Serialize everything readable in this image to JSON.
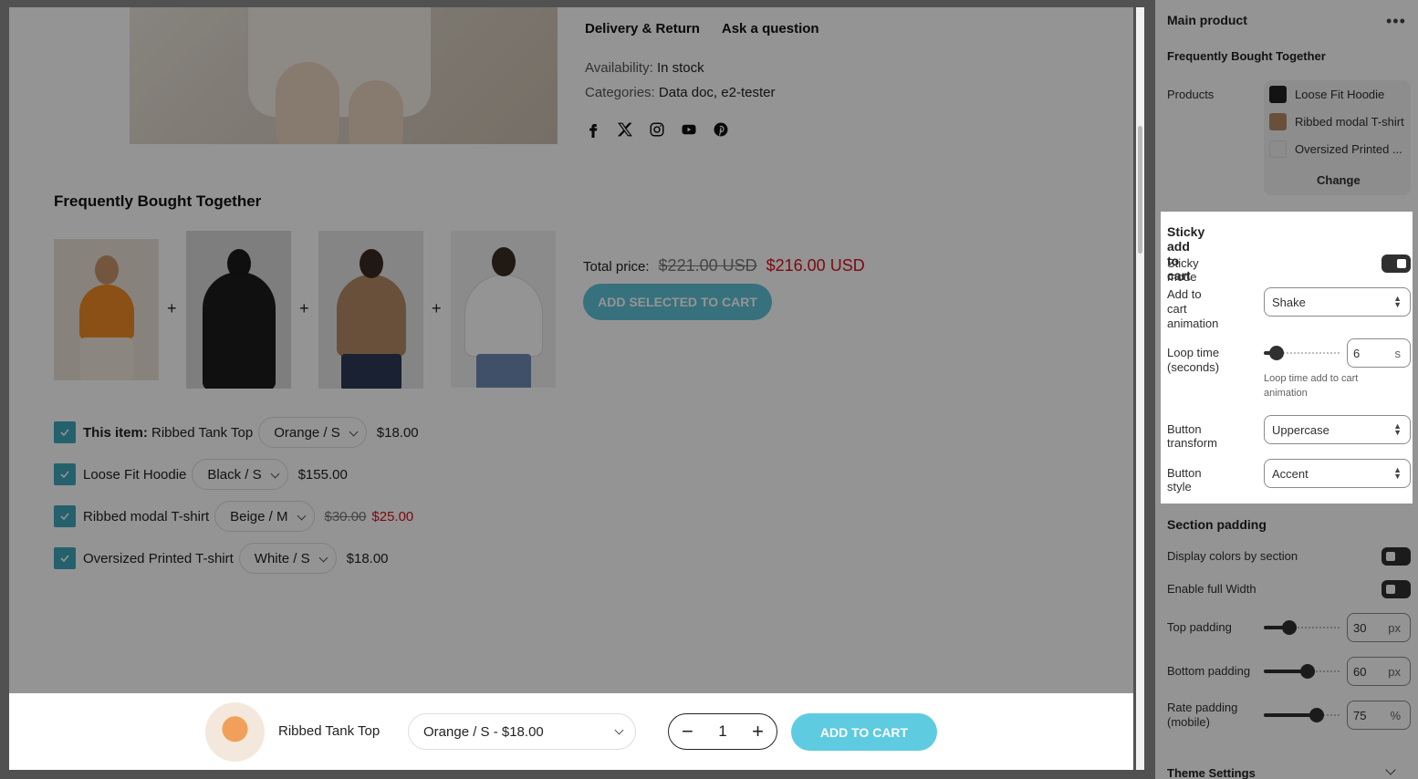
{
  "product_info": {
    "tabs": [
      "Delivery & Return",
      "Ask a question"
    ],
    "availability_label": "Availability:",
    "availability_value": "In stock",
    "categories_label": "Categories:",
    "categories_value": "Data doc, e2-tester",
    "socials": [
      "facebook-icon",
      "x-icon",
      "instagram-icon",
      "youtube-icon",
      "pinterest-icon"
    ]
  },
  "fbt": {
    "title": "Frequently Bought Together",
    "total_label": "Total price:",
    "total_old": "$221.00 USD",
    "total_new": "$216.00 USD",
    "add_button": "ADD SELECTED TO CART",
    "items": [
      {
        "prefix": "This item:",
        "name": "Ribbed Tank Top",
        "variant": "Orange / S",
        "price": "$18.00"
      },
      {
        "name": "Loose Fit Hoodie",
        "variant": "Black / S",
        "price": "$155.00"
      },
      {
        "name": "Ribbed modal T-shirt",
        "variant": "Beige / M",
        "old_price": "$30.00",
        "price": "$25.00"
      },
      {
        "name": "Oversized Printed T-shirt",
        "variant": "White / S",
        "price": "$18.00"
      }
    ]
  },
  "sticky_bar": {
    "product_name": "Ribbed Tank Top",
    "variant": "Orange / S - $18.00",
    "quantity": "1",
    "add_button": "ADD TO CART"
  },
  "panel": {
    "title": "Main product",
    "fbt_heading": "Frequently Bought Together",
    "products_label": "Products",
    "products": [
      "Loose Fit Hoodie",
      "Ribbed modal T-shirt",
      "Oversized Printed ..."
    ],
    "change_label": "Change",
    "sticky": {
      "heading": "Sticky add to cart",
      "mode_label": "Sticky mode",
      "mode_on": true,
      "animation_label_1": "Add to cart",
      "animation_label_2": "animation",
      "animation_value": "Shake",
      "loop_label_1": "Loop time",
      "loop_label_2": "(seconds)",
      "loop_value": "6",
      "loop_unit": "s",
      "loop_help": "Loop time add to cart animation",
      "transform_label": "Button transform",
      "transform_value": "Uppercase",
      "style_label": "Button style",
      "style_value": "Accent"
    },
    "padding": {
      "heading": "Section padding",
      "display_colors_label": "Display colors by section",
      "display_colors_on": false,
      "full_width_label": "Enable full Width",
      "full_width_on": false,
      "top_label": "Top padding",
      "top_value": "30",
      "top_unit": "px",
      "bottom_label": "Bottom padding",
      "bottom_value": "60",
      "bottom_unit": "px",
      "rate_label_1": "Rate padding",
      "rate_label_2": "(mobile)",
      "rate_value": "75",
      "rate_unit": "%"
    },
    "theme_settings": "Theme Settings"
  }
}
